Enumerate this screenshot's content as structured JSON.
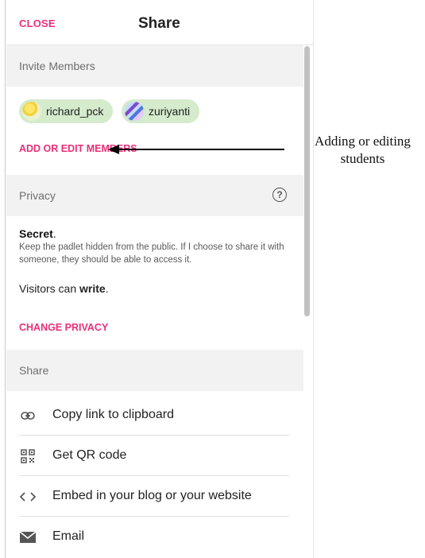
{
  "header": {
    "close_label": "CLOSE",
    "title": "Share"
  },
  "invite": {
    "section_label": "Invite Members",
    "members": [
      {
        "name": "richard_pck"
      },
      {
        "name": "zuriyanti"
      }
    ],
    "edit_link": "ADD OR EDIT MEMBERS"
  },
  "privacy": {
    "section_label": "Privacy",
    "help_icon": "?",
    "mode_title": "Secret",
    "description": "Keep the padlet hidden from the public. If I choose to share it with someone, they should be able to access it.",
    "visitors_prefix": "Visitors can ",
    "visitors_permission": "write",
    "change_link": "CHANGE PRIVACY"
  },
  "share": {
    "section_label": "Share",
    "items": [
      {
        "icon": "link-icon",
        "label": "Copy link to clipboard"
      },
      {
        "icon": "qr-code-icon",
        "label": "Get QR code"
      },
      {
        "icon": "embed-code-icon",
        "label": "Embed in your blog or your website"
      },
      {
        "icon": "email-icon",
        "label": "Email"
      }
    ]
  },
  "annotation": {
    "line1": "Adding or editing",
    "line2": "students"
  },
  "colors": {
    "accent": "#e8307a",
    "chip": "#d4ebcc",
    "section_bg": "#f2f2f2"
  }
}
